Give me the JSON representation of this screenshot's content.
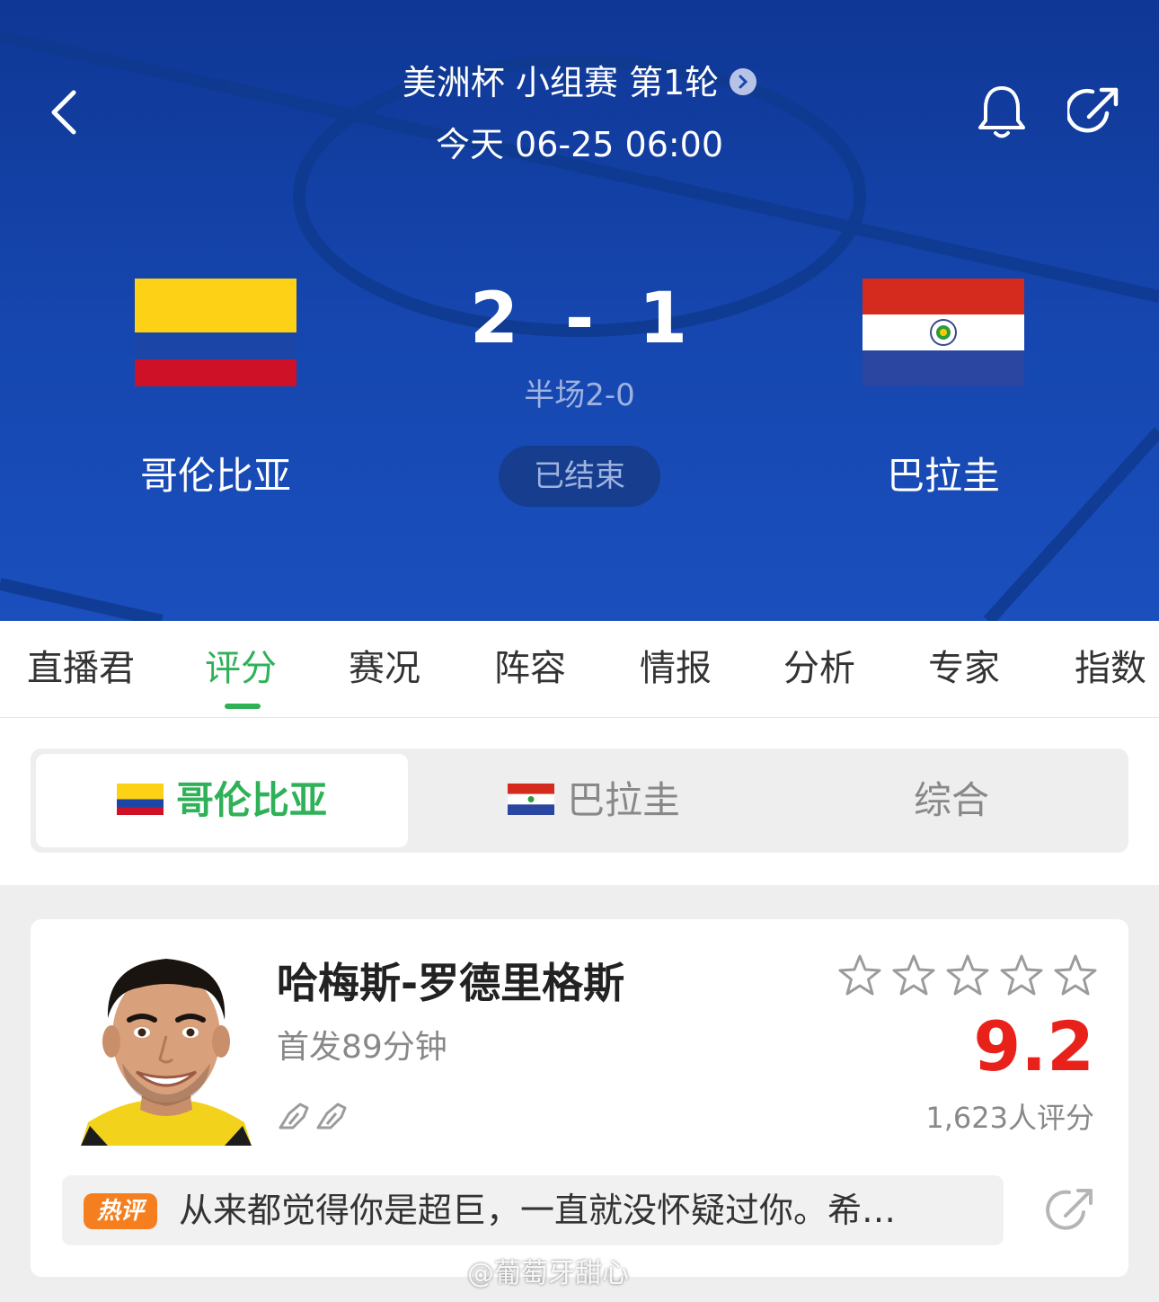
{
  "header": {
    "competition": "美洲杯 小组赛 第1轮",
    "match_time": "今天 06-25 06:00",
    "home_team": "哥伦比亚",
    "away_team": "巴拉圭",
    "home_score": "2",
    "score_separator": "-",
    "away_score": "1",
    "half_time": "半场2-0",
    "status": "已结束",
    "icons": [
      "back-icon",
      "bell-icon",
      "share-icon",
      "chevron-right-icon"
    ]
  },
  "tabs": [
    {
      "label": "直播君"
    },
    {
      "label": "评分"
    },
    {
      "label": "赛况"
    },
    {
      "label": "阵容"
    },
    {
      "label": "情报"
    },
    {
      "label": "分析"
    },
    {
      "label": "专家"
    },
    {
      "label": "指数"
    }
  ],
  "active_tab": "评分",
  "team_selector": {
    "items": [
      "哥伦比亚",
      "巴拉圭",
      "综合"
    ],
    "selected": "哥伦比亚"
  },
  "player": {
    "name": "哈梅斯-罗德里格斯",
    "subtitle": "首发89分钟",
    "rating": "9.2",
    "raters": "1,623人评分",
    "star_count": 5,
    "stars_filled": 0,
    "comment_badge": "热评",
    "comment": "从来都觉得你是超巨，一直就没怀疑过你。希…"
  },
  "watermark": "@葡萄牙甜心",
  "colors": {
    "header_blue": "#1647b0",
    "accent_green": "#2fb158",
    "rating_red": "#e8221b",
    "hot_orange": "#f57f1f"
  }
}
